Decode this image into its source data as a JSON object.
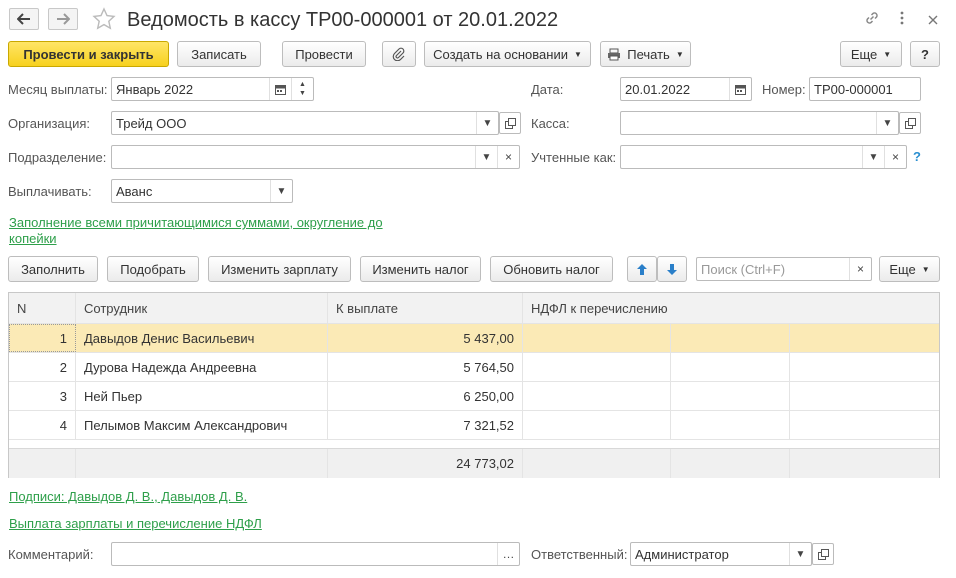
{
  "header": {
    "title": "Ведомость в кассу ТР00-000001 от 20.01.2022"
  },
  "toolbar": {
    "post_close": "Провести и закрыть",
    "save": "Записать",
    "post": "Провести",
    "create_based": "Создать на основании",
    "print": "Печать",
    "more": "Еще",
    "help": "?"
  },
  "form": {
    "month_label": "Месяц выплаты:",
    "month_value": "Январь 2022",
    "date_label": "Дата:",
    "date_value": "20.01.2022",
    "number_label": "Номер:",
    "number_value": "ТР00-000001",
    "org_label": "Организация:",
    "org_value": "Трейд ООО",
    "cash_label": "Касса:",
    "cash_value": "",
    "dept_label": "Подразделение:",
    "dept_value": "",
    "accounted_label": "Учтенные как:",
    "accounted_value": "",
    "pay_label": "Выплачивать:",
    "pay_value": "Аванс",
    "fill_link": "Заполнение всеми причитающимися суммами, округление до",
    "fill_link2": "копейки"
  },
  "table_toolbar": {
    "fill": "Заполнить",
    "pick": "Подобрать",
    "change_salary": "Изменить зарплату",
    "change_tax": "Изменить налог",
    "update_tax": "Обновить налог",
    "search_placeholder": "Поиск (Ctrl+F)",
    "more": "Еще"
  },
  "table": {
    "columns": [
      "N",
      "Сотрудник",
      "К выплате",
      "НДФЛ к перечислению"
    ],
    "rows": [
      {
        "n": "1",
        "employee": "Давыдов Денис Васильевич",
        "amount": "5 437,00"
      },
      {
        "n": "2",
        "employee": "Дурова Надежда Андреевна",
        "amount": "5 764,50"
      },
      {
        "n": "3",
        "employee": "Ней Пьер",
        "amount": "6 250,00"
      },
      {
        "n": "4",
        "employee": "Пелымов Максим Александрович",
        "amount": "7 321,52"
      }
    ],
    "total": "24 773,02"
  },
  "footer": {
    "signatures_link": "Подписи: Давыдов Д. В., Давыдов Д. В.",
    "payroll_link": "Выплата зарплаты и перечисление НДФЛ",
    "comment_label": "Комментарий:",
    "comment_value": "",
    "responsible_label": "Ответственный:",
    "responsible_value": "Администратор"
  },
  "colors": {
    "primary_button": "#f7d11e",
    "link": "#2e9f4a",
    "selected_row": "#fbeab6",
    "help": "#2a8fd0"
  }
}
